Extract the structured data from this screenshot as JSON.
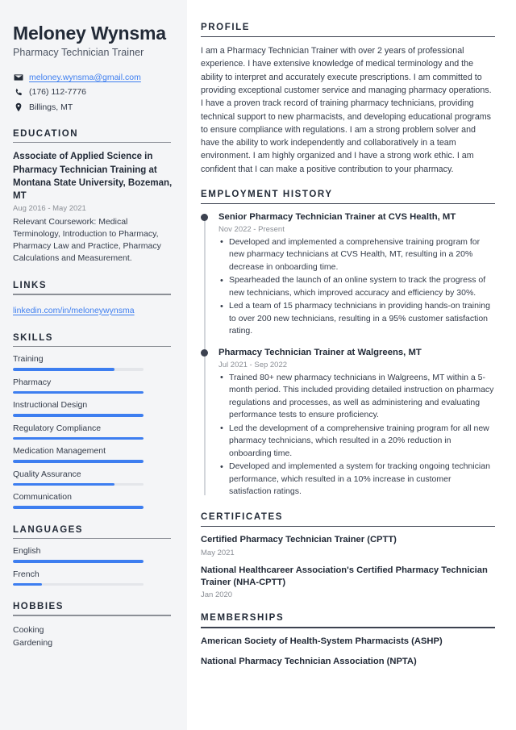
{
  "sidebar": {
    "name": "Meloney Wynsma",
    "job_title": "Pharmacy Technician Trainer",
    "contacts": [
      {
        "icon": "envelope-icon",
        "text": "meloney.wynsma@gmail.com",
        "is_link": true
      },
      {
        "icon": "phone-icon",
        "text": "(176) 112-7776",
        "is_link": false
      },
      {
        "icon": "location-pin-icon",
        "text": "Billings, MT",
        "is_link": false
      }
    ],
    "education": {
      "heading": "EDUCATION",
      "degree": "Associate of Applied Science in Pharmacy Technician Training at Montana State University, Bozeman, MT",
      "date": "Aug 2016 - May 2021",
      "description": "Relevant Coursework: Medical Terminology, Introduction to Pharmacy, Pharmacy Law and Practice, Pharmacy Calculations and Measurement."
    },
    "links": {
      "heading": "LINKS",
      "items": [
        {
          "label": "linkedin.com/in/meloneywynsma"
        }
      ]
    },
    "skills": {
      "heading": "SKILLS",
      "items": [
        {
          "label": "Training",
          "level": 78
        },
        {
          "label": "Pharmacy",
          "level": 100
        },
        {
          "label": "Instructional Design",
          "level": 100
        },
        {
          "label": "Regulatory Compliance",
          "level": 100
        },
        {
          "label": "Medication Management",
          "level": 100
        },
        {
          "label": "Quality Assurance",
          "level": 78
        },
        {
          "label": "Communication",
          "level": 100
        }
      ]
    },
    "languages": {
      "heading": "LANGUAGES",
      "items": [
        {
          "label": "English",
          "level": 100
        },
        {
          "label": "French",
          "level": 22
        }
      ]
    },
    "hobbies": {
      "heading": "HOBBIES",
      "items": [
        {
          "label": "Cooking"
        },
        {
          "label": "Gardening"
        }
      ]
    }
  },
  "main": {
    "profile": {
      "heading": "PROFILE",
      "text": "I am a Pharmacy Technician Trainer with over 2 years of professional experience. I have extensive knowledge of medical terminology and the ability to interpret and accurately execute prescriptions. I am committed to providing exceptional customer service and managing pharmacy operations. I have a proven track record of training pharmacy technicians, providing technical support to new pharmacists, and developing educational programs to ensure compliance with regulations. I am a strong problem solver and have the ability to work independently and collaboratively in a team environment. I am highly organized and I have a strong work ethic. I am confident that I can make a positive contribution to your pharmacy."
    },
    "employment": {
      "heading": "EMPLOYMENT HISTORY",
      "jobs": [
        {
          "title": "Senior Pharmacy Technician Trainer at CVS Health, MT",
          "date": "Nov 2022 - Present",
          "bullets": [
            "Developed and implemented a comprehensive training program for new pharmacy technicians at CVS Health, MT, resulting in a 20% decrease in onboarding time.",
            "Spearheaded the launch of an online system to track the progress of new technicians, which improved accuracy and efficiency by 30%.",
            "Led a team of 15 pharmacy technicians in providing hands-on training to over 200 new technicians, resulting in a 95% customer satisfaction rating."
          ]
        },
        {
          "title": "Pharmacy Technician Trainer at Walgreens, MT",
          "date": "Jul 2021 - Sep 2022",
          "bullets": [
            "Trained 80+ new pharmacy technicians in Walgreens, MT within a 5-month period. This included providing detailed instruction on pharmacy regulations and processes, as well as administering and evaluating performance tests to ensure proficiency.",
            "Led the development of a comprehensive training program for all new pharmacy technicians, which resulted in a 20% reduction in onboarding time.",
            "Developed and implemented a system for tracking ongoing technician performance, which resulted in a 10% increase in customer satisfaction ratings."
          ]
        }
      ]
    },
    "certificates": {
      "heading": "CERTIFICATES",
      "items": [
        {
          "title": "Certified Pharmacy Technician Trainer (CPTT)",
          "date": "May 2021"
        },
        {
          "title": "National Healthcareer Association's Certified Pharmacy Technician Trainer (NHA-CPTT)",
          "date": "Jan 2020"
        }
      ]
    },
    "memberships": {
      "heading": "MEMBERSHIPS",
      "items": [
        {
          "title": "American Society of Health-System Pharmacists (ASHP)"
        },
        {
          "title": "National Pharmacy Technician Association (NPTA)"
        }
      ]
    }
  },
  "colors": {
    "accent": "#3d7ef0",
    "sidebar_bg": "#f4f5f7",
    "heading": "#222a37",
    "muted": "#8b8f96"
  }
}
